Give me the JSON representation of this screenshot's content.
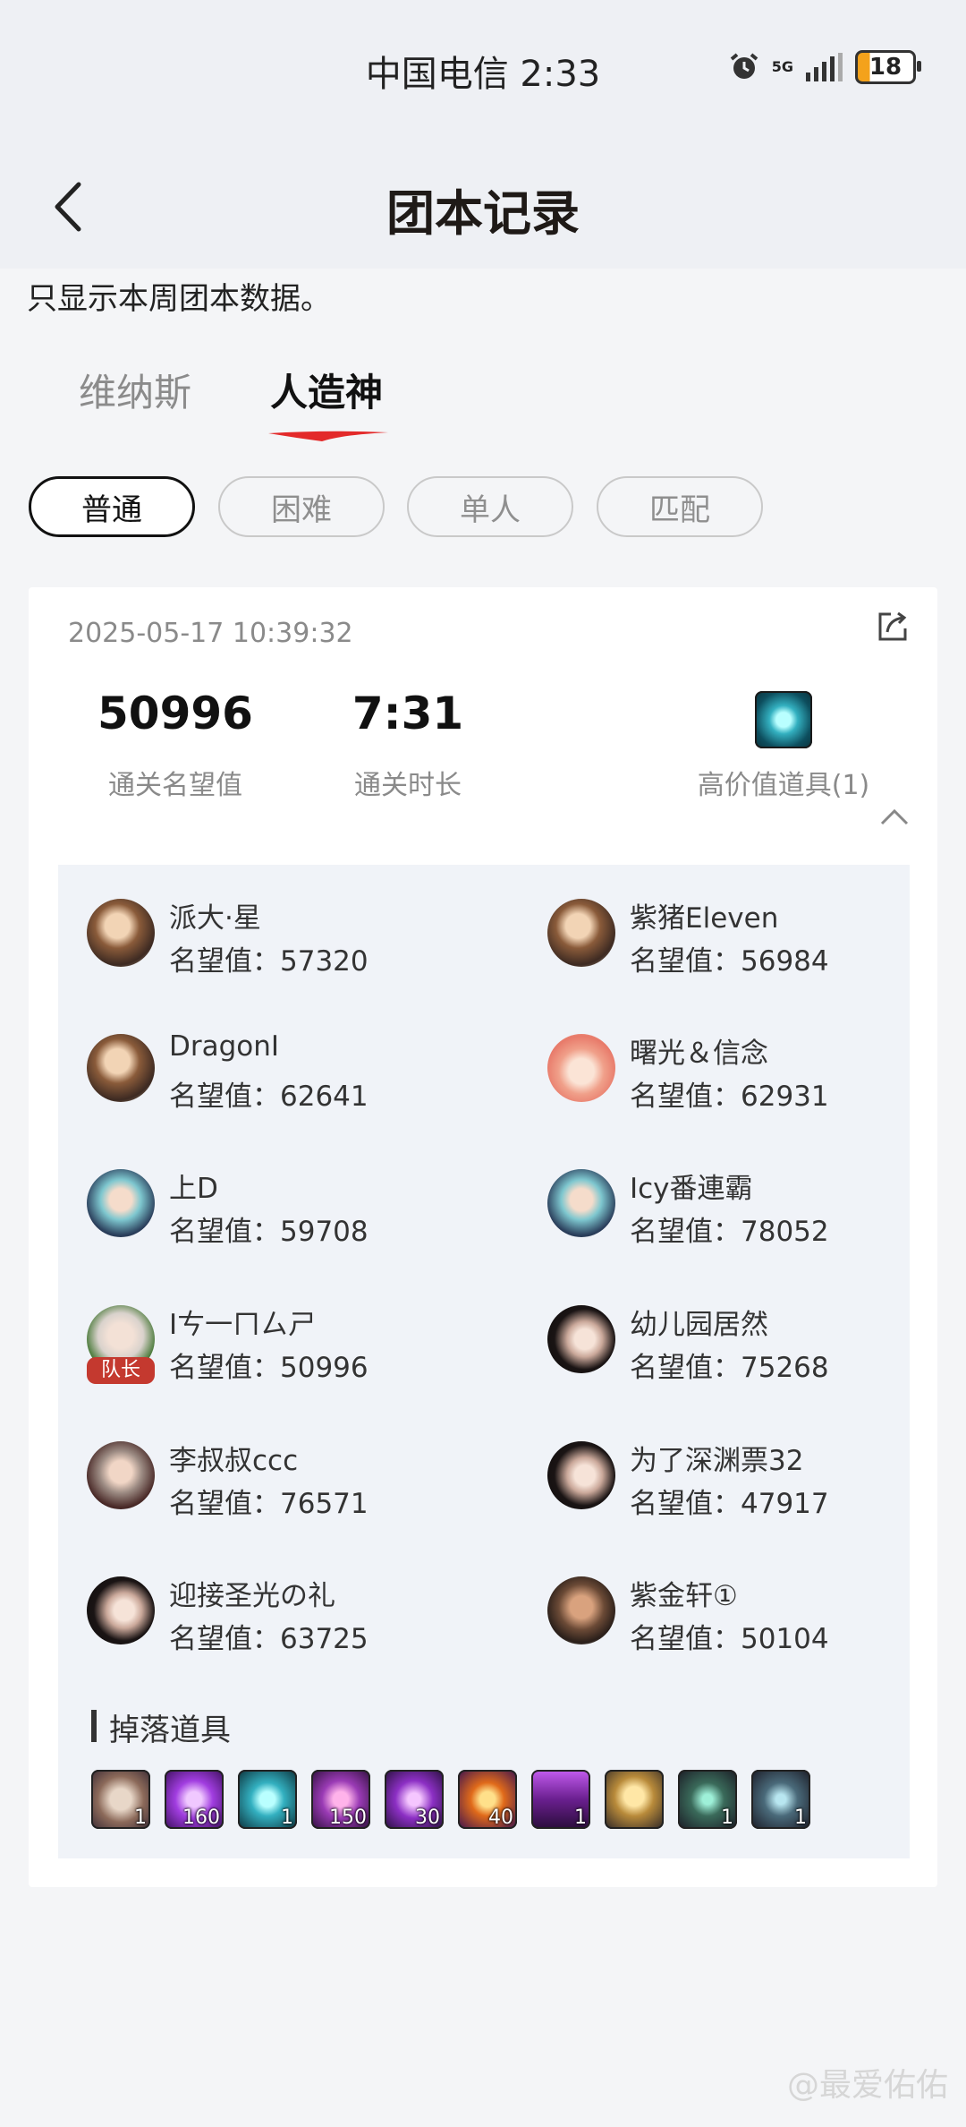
{
  "status_bar": {
    "carrier_time": "中国电信 2:33",
    "network": "5G",
    "battery": "18"
  },
  "header": {
    "title": "团本记录"
  },
  "notice": "只显示本周团本数据。",
  "raid_tabs": [
    {
      "label": "维纳斯"
    },
    {
      "label": "人造神"
    }
  ],
  "difficulty": [
    {
      "label": "普通"
    },
    {
      "label": "困难"
    },
    {
      "label": "单人"
    },
    {
      "label": "匹配"
    }
  ],
  "record": {
    "date": "2025-05-17 10:39:32",
    "reputation_value": "50996",
    "reputation_label": "通关名望值",
    "time_value": "7:31",
    "time_label": "通关时长",
    "items_label": "高价值道具(1)"
  },
  "members": [
    {
      "name": "派大·星",
      "rep": "名望值：57320"
    },
    {
      "name": "紫猪Eleven",
      "rep": "名望值：56984"
    },
    {
      "name": "DragonI",
      "rep": "名望值：62641"
    },
    {
      "name": "曙光＆信念",
      "rep": "名望值：62931"
    },
    {
      "name": "上D",
      "rep": "名望值：59708"
    },
    {
      "name": "Icy番連霸",
      "rep": "名望值：78052"
    },
    {
      "name": "Iㄘ一ㄇㄙㄕ",
      "rep": "名望值：50996",
      "badge": "队长"
    },
    {
      "name": "幼儿园居然",
      "rep": "名望值：75268"
    },
    {
      "name": "李叔叔ccc",
      "rep": "名望值：76571"
    },
    {
      "name": "为了深渊票32",
      "rep": "名望值：47917"
    },
    {
      "name": "迎接圣光の礼",
      "rep": "名望值：63725"
    },
    {
      "name": "紫金轩①",
      "rep": "名望值：50104"
    }
  ],
  "drops": {
    "title": "掉落道具",
    "items": [
      {
        "count": "1"
      },
      {
        "count": "160"
      },
      {
        "count": "1"
      },
      {
        "count": "150"
      },
      {
        "count": "30"
      },
      {
        "count": "40"
      },
      {
        "count": "1"
      },
      {
        "count": ""
      },
      {
        "count": "1"
      },
      {
        "count": "1"
      }
    ]
  },
  "watermark": "@最爱佑佑"
}
